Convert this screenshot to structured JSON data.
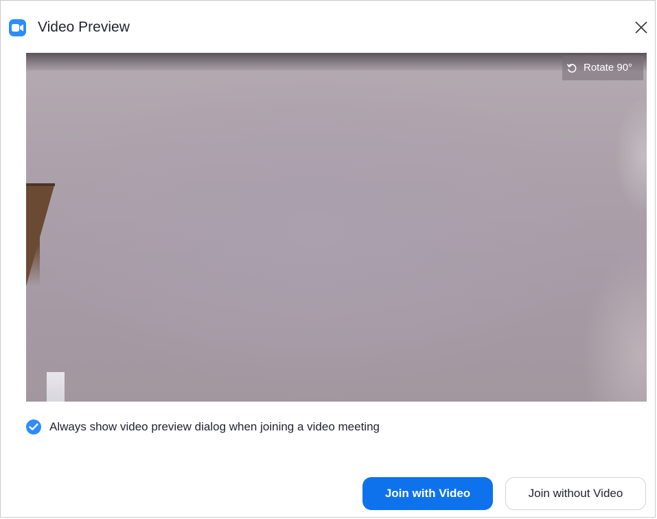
{
  "window": {
    "title": "Video Preview",
    "app_icon": "zoom-video-icon",
    "close_icon": "close-icon"
  },
  "video": {
    "rotate_label": "Rotate 90°",
    "rotate_icon": "rotate-icon"
  },
  "options": {
    "always_show_label": "Always show video preview dialog when joining a video meeting",
    "always_show_checked": true
  },
  "actions": {
    "join_with_video": "Join with Video",
    "join_without_video": "Join without Video"
  },
  "colors": {
    "accent": "#0e72ed",
    "brand": "#2d8cff",
    "text": "#232333"
  }
}
